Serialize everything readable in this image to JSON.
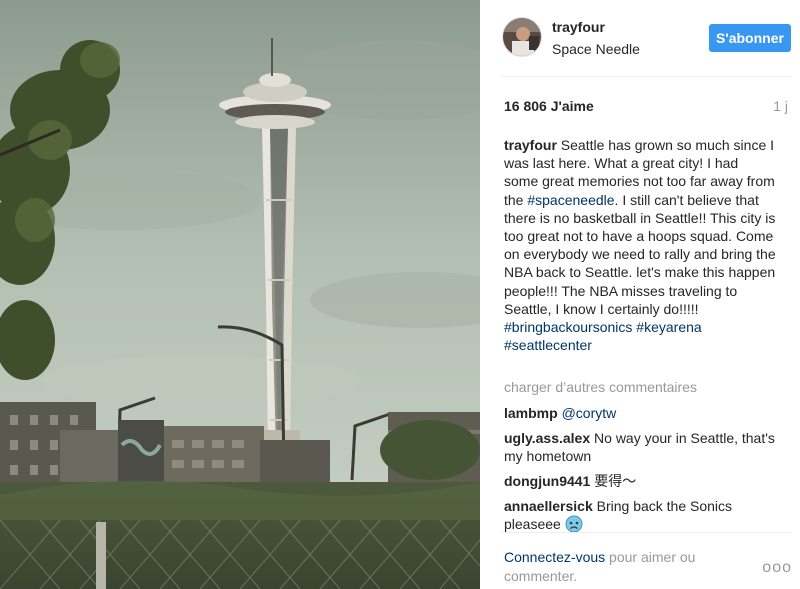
{
  "header": {
    "username": "trayfour",
    "location": "Space Needle",
    "follow_label": "S'abonner"
  },
  "stats": {
    "likes": "16 806 J'aime",
    "time": "1 j"
  },
  "caption": {
    "username": "trayfour",
    "text_1": " Seattle has grown so much since I was last here. What a great city! I had some great memories not too far away from the ",
    "tag_1": "#spaceneedle",
    "text_2": ". I still can't believe that there is no basketball in Seattle!! This city is too great not to have a hoops squad. Come on everybody we need to rally and bring the NBA back to Seattle. let's make this happen people!!! The NBA misses traveling to Seattle, I know I certainly do!!!!! ",
    "tag_2": "#bringbackoursonics",
    "tag_3": "#keyarena",
    "tag_4": "#seattlecenter"
  },
  "load_more": "charger d’autres commentaires",
  "comments": [
    {
      "user": "lambmp",
      "text": "",
      "mention": "@corytw"
    },
    {
      "user": "ugly.ass.alex",
      "text": " No way your in Seattle, that's my hometown"
    },
    {
      "user": "dongjun9441",
      "text": " 要得～"
    },
    {
      "user": "annaellersick",
      "text": " Bring back the Sonics pleaseee "
    }
  ],
  "footer": {
    "login_link": "Connectez-vous",
    "login_text": " pour aimer ou commenter.",
    "more_label": "ooo"
  },
  "colors": {
    "accent": "#3897f0",
    "hashtag": "#003569",
    "muted": "#999999"
  },
  "icons": {
    "more": "more-options-icon",
    "emoji": "worried-face-icon"
  }
}
